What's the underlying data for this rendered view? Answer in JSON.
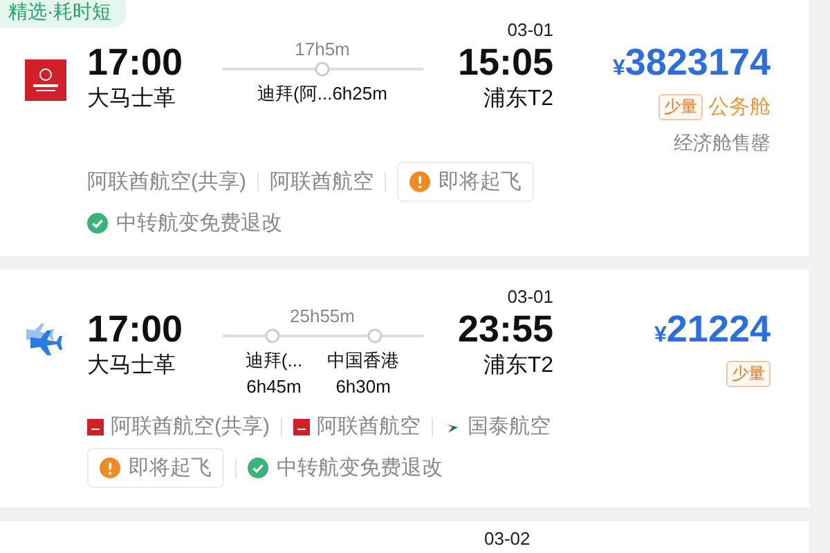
{
  "flights": [
    {
      "tag": "精选·耗时短",
      "logo": {
        "kind": "emirates"
      },
      "depart_time": "17:00",
      "origin": "大马士革",
      "route": {
        "kind": "inline",
        "duration": "17h5m",
        "stops": [
          {
            "name": "迪拜(阿...",
            "duration": "6h25m"
          }
        ]
      },
      "arrival_date": "03-01",
      "arrival_time": "15:05",
      "destination": "浦东T2",
      "price": "¥3823174",
      "badge": "少量",
      "cabin": "公务舱",
      "note": "经济舱售罄",
      "info_rows": [
        [
          {
            "kind": "airline",
            "text": "阿联酋航空(共享)"
          },
          {
            "kind": "airline",
            "text": "阿联酋航空"
          },
          {
            "kind": "warning",
            "text": "即将起飞"
          }
        ],
        [
          {
            "kind": "check",
            "text": "中转航变免费退改"
          }
        ]
      ]
    },
    {
      "logo": {
        "kind": "plane"
      },
      "depart_time": "17:00",
      "origin": "大马士革",
      "route": {
        "kind": "stacked",
        "duration": "25h55m",
        "stops": [
          {
            "name": "迪拜(...",
            "duration": "6h45m"
          },
          {
            "name": "中国香港",
            "duration": "6h30m"
          }
        ]
      },
      "arrival_date": "03-01",
      "arrival_time": "23:55",
      "destination": "浦东T2",
      "price": "¥21224",
      "badge": "少量",
      "info_rows": [
        [
          {
            "kind": "airline",
            "logo": {
              "kind": "emirates"
            },
            "text": "阿联酋航空(共享)"
          },
          {
            "kind": "airline",
            "logo": {
              "kind": "emirates"
            },
            "text": "阿联酋航空"
          },
          {
            "kind": "airline",
            "logo": {
              "kind": "cathay"
            },
            "text": "国泰航空"
          }
        ],
        [
          {
            "kind": "warning",
            "text": "即将起飞"
          },
          {
            "kind": "check",
            "text": "中转航变免费退改"
          }
        ]
      ]
    }
  ],
  "next_card": {
    "arrival_date": "03-02"
  }
}
